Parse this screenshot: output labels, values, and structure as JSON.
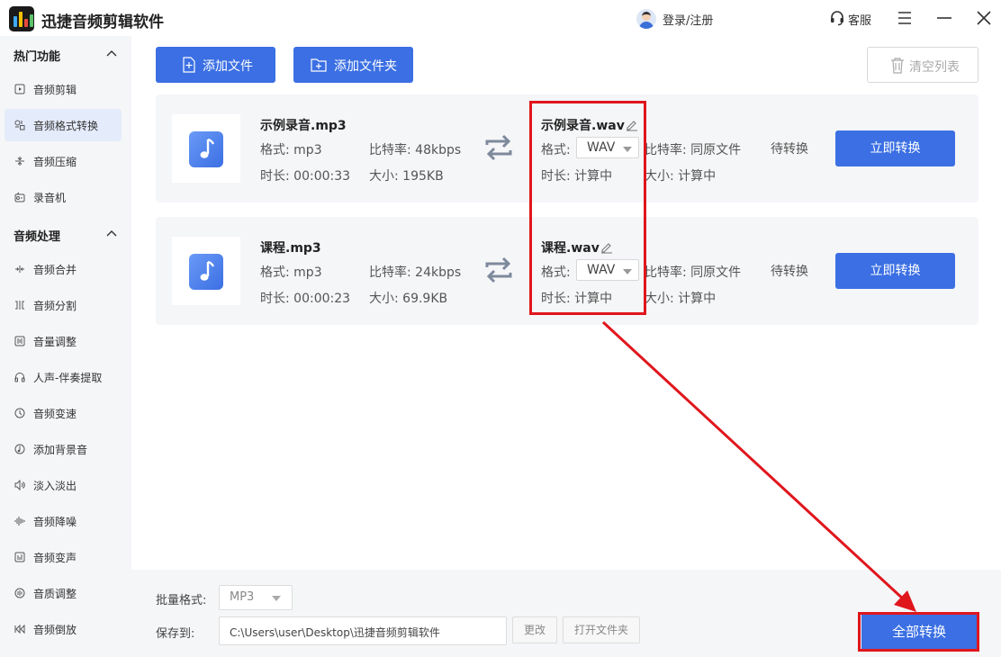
{
  "app": {
    "title": "迅捷音频剪辑软件"
  },
  "header": {
    "login": "登录/注册",
    "service": "客服"
  },
  "sidebar": {
    "section1": {
      "title": "热门功能",
      "items": [
        {
          "label": "音频剪辑",
          "icon": "audio-cut-icon"
        },
        {
          "label": "音频格式转换",
          "icon": "format-convert-icon",
          "active": true
        },
        {
          "label": "音频压缩",
          "icon": "compress-icon"
        },
        {
          "label": "录音机",
          "icon": "recorder-icon"
        }
      ]
    },
    "section2": {
      "title": "音频处理",
      "items": [
        {
          "label": "音频合并",
          "icon": "merge-icon"
        },
        {
          "label": "音频分割",
          "icon": "split-icon"
        },
        {
          "label": "音量调整",
          "icon": "volume-icon"
        },
        {
          "label": "人声-伴奏提取",
          "icon": "vocal-extract-icon"
        },
        {
          "label": "音频变速",
          "icon": "speed-icon"
        },
        {
          "label": "添加背景音",
          "icon": "background-music-icon"
        },
        {
          "label": "淡入淡出",
          "icon": "fade-icon"
        },
        {
          "label": "音频降噪",
          "icon": "denoise-icon"
        },
        {
          "label": "音频变声",
          "icon": "voice-change-icon"
        },
        {
          "label": "音质调整",
          "icon": "quality-icon"
        },
        {
          "label": "音频倒放",
          "icon": "reverse-icon"
        }
      ]
    }
  },
  "toolbar": {
    "add_file": "添加文件",
    "add_folder": "添加文件夹",
    "clear_list": "清空列表"
  },
  "files": [
    {
      "name": "示例录音.mp3",
      "format_label": "格式:",
      "format": "mp3",
      "bitrate_label": "比特率:",
      "bitrate": "48kbps",
      "duration_label": "时长:",
      "duration": "00:00:33",
      "size_label": "大小:",
      "size": "195KB",
      "output_name": "示例录音.wav",
      "output_format": "WAV",
      "output_bitrate": "同原文件",
      "output_duration": "计算中",
      "output_size": "计算中",
      "status": "待转换",
      "convert": "立即转换"
    },
    {
      "name": "课程.mp3",
      "format_label": "格式:",
      "format": "mp3",
      "bitrate_label": "比特率:",
      "bitrate": "24kbps",
      "duration_label": "时长:",
      "duration": "00:00:23",
      "size_label": "大小:",
      "size": "69.9KB",
      "output_name": "课程.wav",
      "output_format": "WAV",
      "output_bitrate": "同原文件",
      "output_duration": "计算中",
      "output_size": "计算中",
      "status": "待转换",
      "convert": "立即转换"
    }
  ],
  "footer": {
    "batch_label": "批量格式:",
    "batch_format": "MP3",
    "save_label": "保存到:",
    "save_path": "C:\\Users\\user\\Desktop\\迅捷音频剪辑软件",
    "change": "更改",
    "open_folder": "打开文件夹",
    "convert_all": "全部转换"
  },
  "colors": {
    "accent": "#3b6fe3",
    "highlight": "#e0161d",
    "sidebar_bg": "#f5f6f8"
  }
}
